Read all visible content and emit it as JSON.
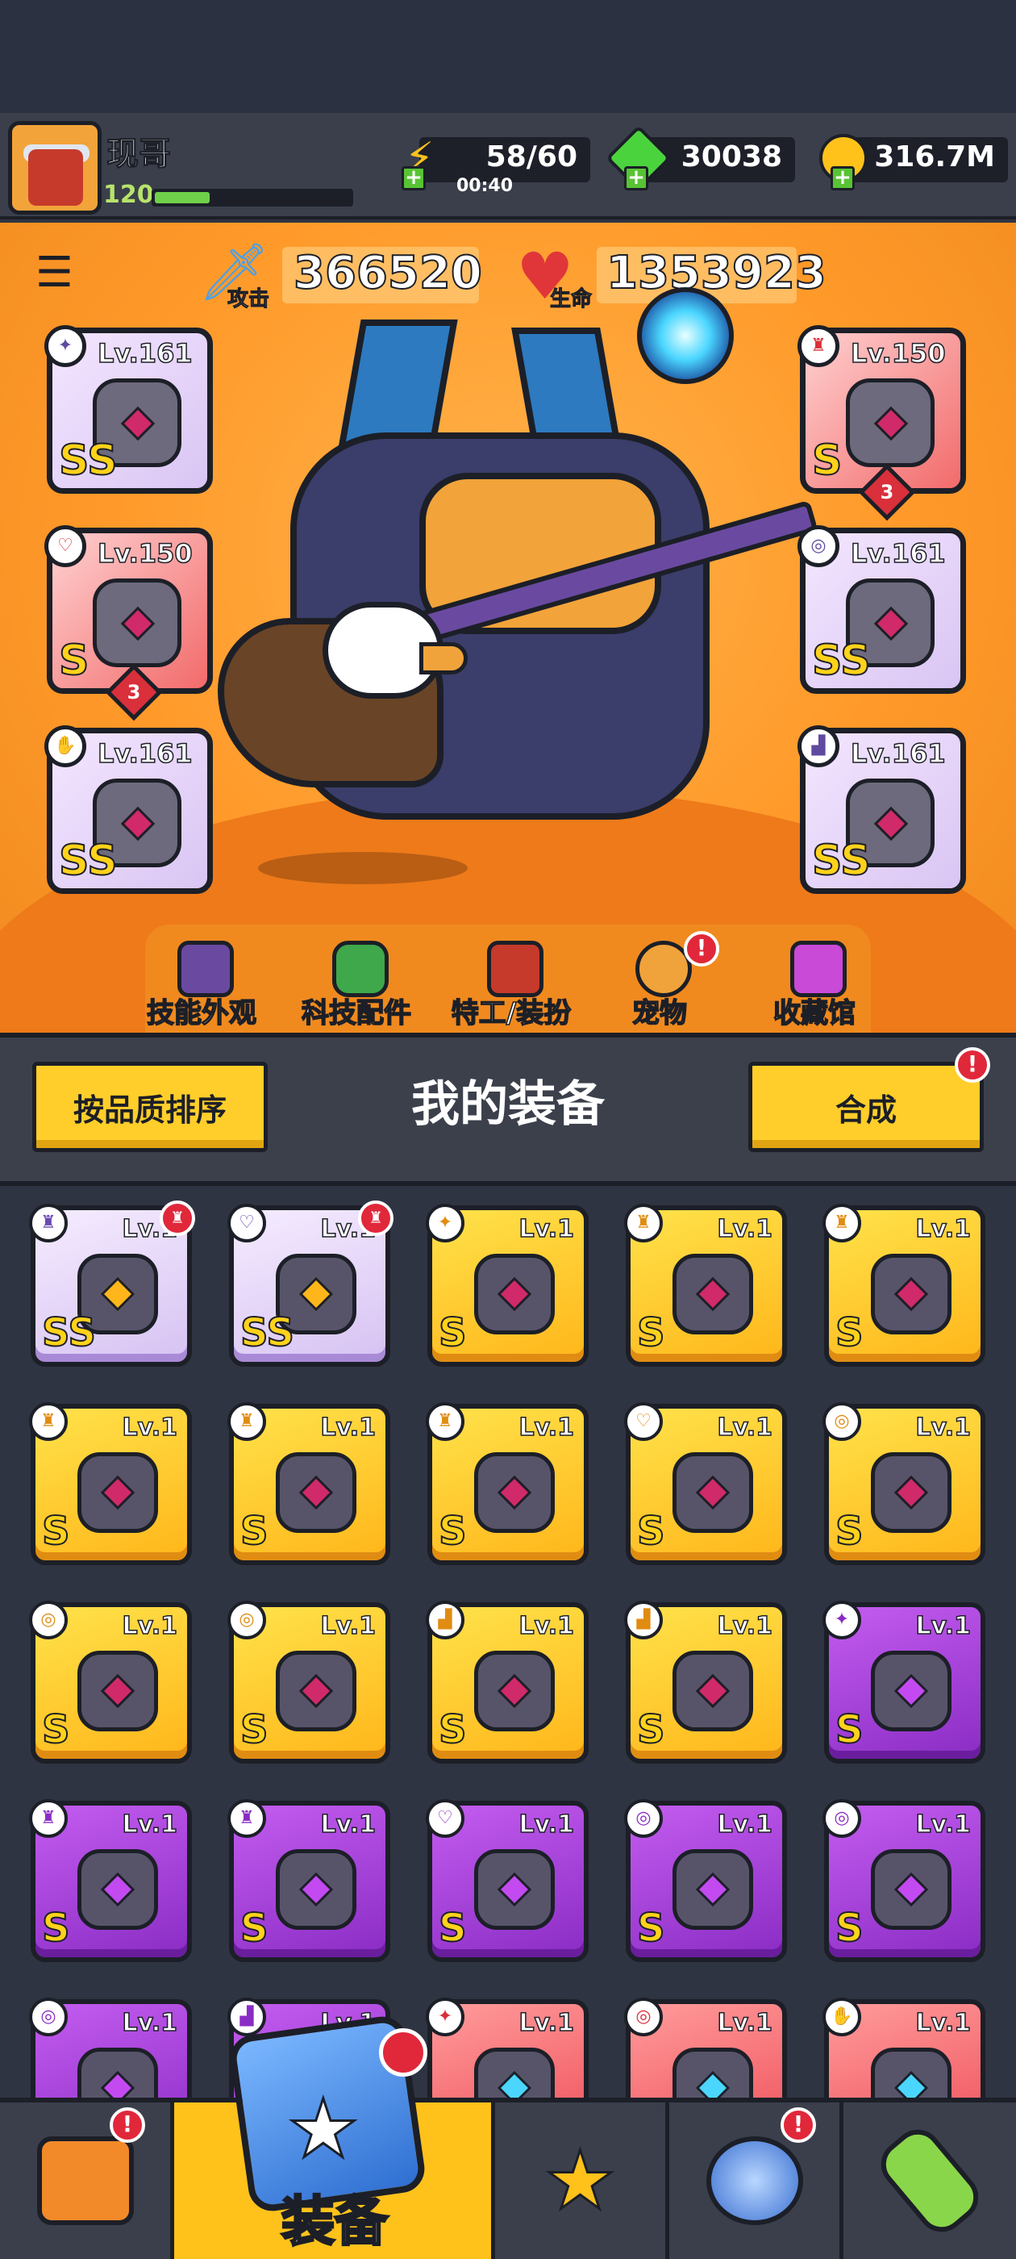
{
  "player": {
    "name": "现哥",
    "level": "120",
    "xp_fraction": 0.28
  },
  "resources": {
    "energy": {
      "value": "58/60",
      "timer": "00:40",
      "icon": "lightning-icon"
    },
    "gems": {
      "value": "30038",
      "icon": "gem-icon"
    },
    "gold": {
      "value": "316.7M",
      "icon": "gold-coin-icon"
    }
  },
  "stats": {
    "attack_label": "攻击",
    "attack_value": "366520",
    "hp_label": "生命",
    "hp_value": "1353923"
  },
  "equipped": {
    "left": [
      {
        "name": "weapon",
        "icon": "wand-icon",
        "level": "Lv.161",
        "grade": "SS",
        "rarity": "purple"
      },
      {
        "name": "necklace",
        "icon": "necklace-icon",
        "level": "Lv.150",
        "grade": "S",
        "rarity": "red",
        "stars": "3"
      },
      {
        "name": "gloves",
        "icon": "glove-icon",
        "level": "Lv.161",
        "grade": "SS",
        "rarity": "purple"
      }
    ],
    "right": [
      {
        "name": "armor",
        "icon": "armor-icon",
        "level": "Lv.150",
        "grade": "S",
        "rarity": "red",
        "stars": "3"
      },
      {
        "name": "belt",
        "icon": "belt-icon",
        "level": "Lv.161",
        "grade": "SS",
        "rarity": "purple"
      },
      {
        "name": "boots",
        "icon": "boots-icon",
        "level": "Lv.161",
        "grade": "SS",
        "rarity": "purple"
      }
    ]
  },
  "stage_nav": [
    {
      "label": "技能外观",
      "icon": "skill-skin-icon",
      "alert": false
    },
    {
      "label": "科技配件",
      "icon": "tech-part-icon",
      "alert": false
    },
    {
      "label": "特工/装扮",
      "icon": "agent-icon",
      "alert": false
    },
    {
      "label": "宠物",
      "icon": "pet-shiba-icon",
      "alert": true
    },
    {
      "label": "收藏馆",
      "icon": "collection-chest-icon",
      "alert": false
    }
  ],
  "panel": {
    "sort_label": "按品质排序",
    "title": "我的装备",
    "merge_label": "合成",
    "alert_mark": "!"
  },
  "inventory": [
    {
      "rarity": "lilac",
      "level": "Lv.1",
      "grade": "SS",
      "icon": "armor-icon",
      "new": true
    },
    {
      "rarity": "lilac",
      "level": "Lv.1",
      "grade": "SS",
      "icon": "necklace-icon",
      "new": true
    },
    {
      "rarity": "gold",
      "level": "Lv.1",
      "grade": "S",
      "icon": "wand-icon",
      "new": false
    },
    {
      "rarity": "gold",
      "level": "Lv.1",
      "grade": "S",
      "icon": "armor-icon",
      "new": false
    },
    {
      "rarity": "gold",
      "level": "Lv.1",
      "grade": "S",
      "icon": "armor-icon",
      "new": false
    },
    {
      "rarity": "gold",
      "level": "Lv.1",
      "grade": "S",
      "icon": "armor-icon",
      "new": false
    },
    {
      "rarity": "gold",
      "level": "Lv.1",
      "grade": "S",
      "icon": "armor-icon",
      "new": false
    },
    {
      "rarity": "gold",
      "level": "Lv.1",
      "grade": "S",
      "icon": "armor-icon",
      "new": false
    },
    {
      "rarity": "gold",
      "level": "Lv.1",
      "grade": "S",
      "icon": "necklace-icon",
      "new": false
    },
    {
      "rarity": "gold",
      "level": "Lv.1",
      "grade": "S",
      "icon": "belt-icon",
      "new": false
    },
    {
      "rarity": "gold",
      "level": "Lv.1",
      "grade": "S",
      "icon": "belt-icon",
      "new": false
    },
    {
      "rarity": "gold",
      "level": "Lv.1",
      "grade": "S",
      "icon": "belt-icon",
      "new": false
    },
    {
      "rarity": "gold",
      "level": "Lv.1",
      "grade": "S",
      "icon": "boots-icon",
      "new": false
    },
    {
      "rarity": "gold",
      "level": "Lv.1",
      "grade": "S",
      "icon": "boots-icon",
      "new": false
    },
    {
      "rarity": "purple",
      "level": "Lv.1",
      "grade": "S",
      "icon": "wand-icon",
      "new": false
    },
    {
      "rarity": "purple",
      "level": "Lv.1",
      "grade": "S",
      "icon": "armor-icon",
      "new": false
    },
    {
      "rarity": "purple",
      "level": "Lv.1",
      "grade": "S",
      "icon": "armor-icon",
      "new": false
    },
    {
      "rarity": "purple",
      "level": "Lv.1",
      "grade": "S",
      "icon": "necklace-icon",
      "new": false
    },
    {
      "rarity": "purple",
      "level": "Lv.1",
      "grade": "S",
      "icon": "belt-icon",
      "new": false
    },
    {
      "rarity": "purple",
      "level": "Lv.1",
      "grade": "S",
      "icon": "belt-icon",
      "new": false
    },
    {
      "rarity": "purple",
      "level": "Lv.1",
      "grade": "",
      "icon": "belt-icon",
      "new": false
    },
    {
      "rarity": "purple",
      "level": "Lv.1",
      "grade": "",
      "icon": "boots-icon",
      "new": false
    },
    {
      "rarity": "red",
      "level": "Lv.1",
      "grade": "",
      "icon": "wand-icon",
      "new": false
    },
    {
      "rarity": "red",
      "level": "Lv.1",
      "grade": "",
      "icon": "belt-icon",
      "new": false
    },
    {
      "rarity": "red",
      "level": "Lv.1",
      "grade": "",
      "icon": "glove-icon",
      "new": false
    }
  ],
  "tabs": [
    {
      "name": "shop",
      "icon": "shop-stall-icon",
      "alert": true
    },
    {
      "name": "equipment",
      "label": "装备",
      "icon": "equipment-icon",
      "alert": true
    },
    {
      "name": "battle",
      "icon": "crossed-swords-star-icon",
      "alert": false
    },
    {
      "name": "explore",
      "icon": "planet-icon",
      "alert": true
    },
    {
      "name": "lab",
      "icon": "dna-capsule-icon",
      "alert": false
    }
  ],
  "colors": {
    "gold_rarity": "#ffc21b",
    "purple_rarity": "#a23fdc",
    "red_rarity": "#ee4d57",
    "lilac_rarity": "#d6c2f2"
  }
}
